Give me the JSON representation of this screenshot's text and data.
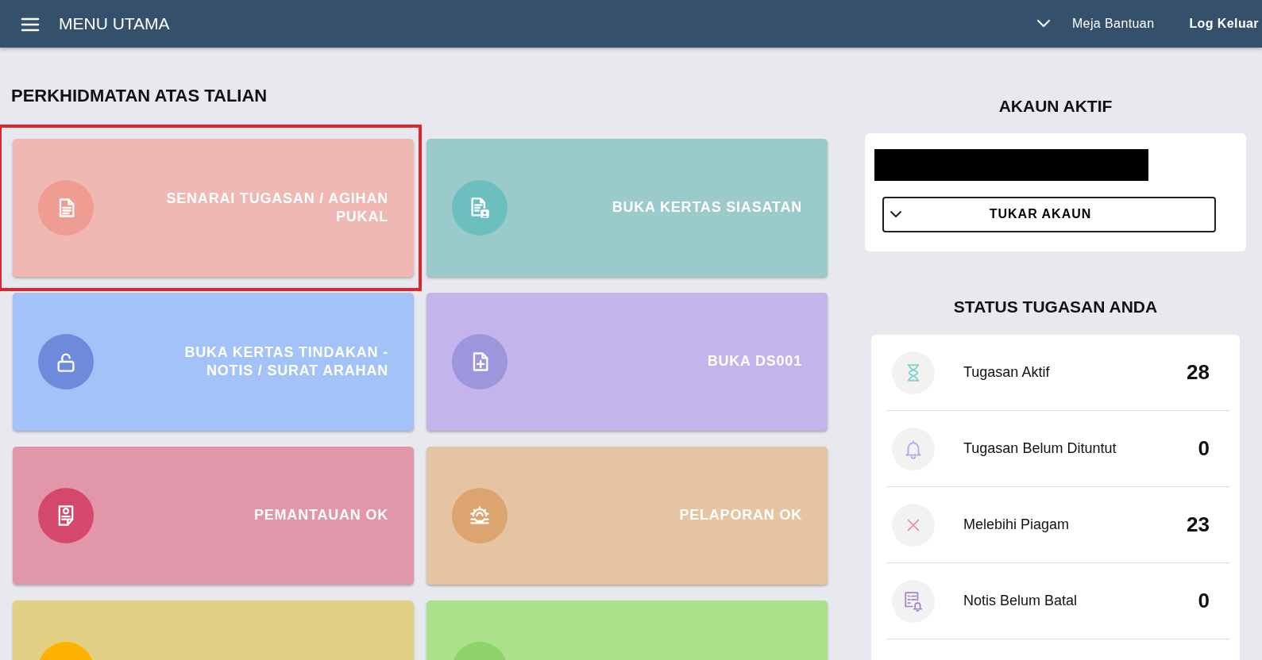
{
  "navbar": {
    "title": "MENU UTAMA",
    "links": [
      "Meja Bantuan",
      "Log Keluar"
    ]
  },
  "services": {
    "heading": "PERKHIDMATAN ATAS TALIAN",
    "tiles": [
      {
        "label": "SENARAI TUGASAN / AGIHAN PUKAL",
        "color": "#f0b8b2",
        "icon_circle": {
          "color": "#ef9d93"
        },
        "highlighted": true
      },
      {
        "label": "BUKA KERTAS SIASATAN",
        "color": "#9bcacb",
        "icon_circle": {
          "color": "#6dbfbf"
        },
        "highlighted": false
      },
      {
        "label": "BUKA KERTAS TINDAKAN - NOTIS / SURAT ARAHAN",
        "color": "#a2c2f8",
        "icon_circle": {
          "color": "#6d8bda"
        },
        "highlighted": false
      },
      {
        "label": "BUKA DS001",
        "color": "#c4b4ec",
        "icon_circle": {
          "color": "#9e96dc"
        },
        "highlighted": false
      },
      {
        "label": "PEMANTAUAN OK",
        "color": "#e196aa",
        "icon_circle": {
          "color": "#d4496b"
        },
        "highlighted": false
      },
      {
        "label": "PELAPORAN OK",
        "color": "#e6c3a1",
        "icon_circle": {
          "color": "#dca46e"
        },
        "highlighted": false
      },
      {
        "color": "#e3d084",
        "icon_circle": {
          "color": "#ffb300"
        },
        "highlighted": false
      },
      {
        "color": "#abe18b",
        "icon_circle": {
          "color": "#8fd16a"
        },
        "highlighted": false
      }
    ]
  },
  "account": {
    "heading": "AKAUN AKTIF",
    "button": "TUKAR AKAUN"
  },
  "status": {
    "heading": "STATUS TUGASAN ANDA",
    "items": [
      {
        "label": "Tugasan Aktif",
        "count": "28"
      },
      {
        "label": "Tugasan Belum Dituntut",
        "count": "0"
      },
      {
        "label": "Melebihi Piagam",
        "count": "23"
      },
      {
        "label": "Notis Belum Batal",
        "count": "0"
      }
    ]
  }
}
